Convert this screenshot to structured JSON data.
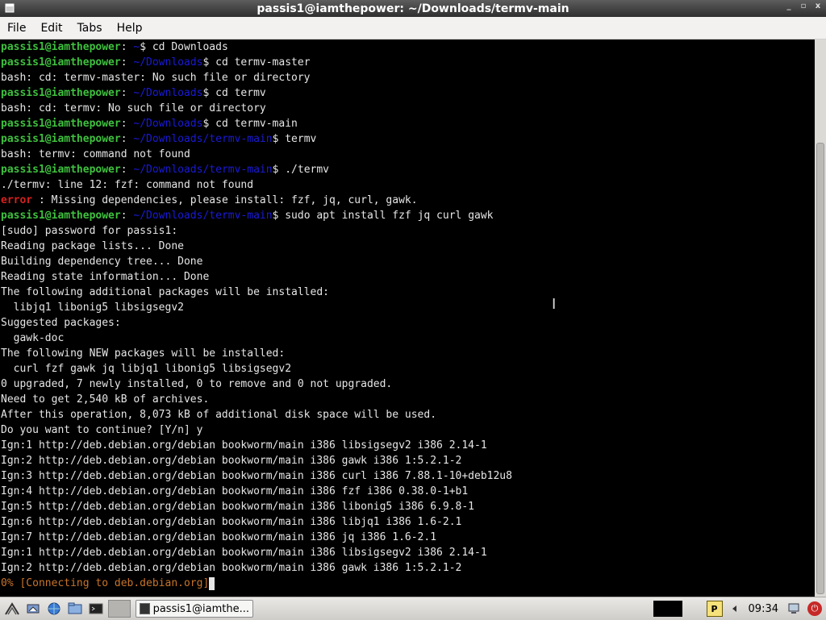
{
  "window": {
    "title": "passis1@iamthepower: ~/Downloads/termv-main",
    "controls": [
      "_",
      "▫",
      "x"
    ]
  },
  "menubar": {
    "items": [
      "File",
      "Edit",
      "Tabs",
      "Help"
    ]
  },
  "terminal": {
    "lines": [
      {
        "type": "prompt",
        "host": "passis1@iamthepower",
        "path": "~",
        "cmd": "$ cd Downloads"
      },
      {
        "type": "prompt",
        "host": "passis1@iamthepower",
        "path": "~/Downloads",
        "cmd": "$ cd termv-master"
      },
      {
        "type": "out",
        "text": "bash: cd: termv-master: No such file or directory"
      },
      {
        "type": "prompt",
        "host": "passis1@iamthepower",
        "path": "~/Downloads",
        "cmd": "$ cd termv"
      },
      {
        "type": "out",
        "text": "bash: cd: termv: No such file or directory"
      },
      {
        "type": "prompt",
        "host": "passis1@iamthepower",
        "path": "~/Downloads",
        "cmd": "$ cd termv-main"
      },
      {
        "type": "prompt",
        "host": "passis1@iamthepower",
        "path": "~/Downloads/termv-main",
        "cmd": "$ termv"
      },
      {
        "type": "out",
        "text": "bash: termv: command not found"
      },
      {
        "type": "prompt",
        "host": "passis1@iamthepower",
        "path": "~/Downloads/termv-main",
        "cmd": "$ ./termv"
      },
      {
        "type": "out",
        "text": "./termv: line 12: fzf: command not found"
      },
      {
        "type": "error",
        "label": "error",
        "text": " : Missing dependencies, please install: fzf, jq, curl, gawk."
      },
      {
        "type": "prompt",
        "host": "passis1@iamthepower",
        "path": "~/Downloads/termv-main",
        "cmd": "$ sudo apt install fzf jq curl gawk"
      },
      {
        "type": "out",
        "text": "[sudo] password for passis1:"
      },
      {
        "type": "out",
        "text": "Reading package lists... Done"
      },
      {
        "type": "out",
        "text": "Building dependency tree... Done"
      },
      {
        "type": "out",
        "text": "Reading state information... Done"
      },
      {
        "type": "out",
        "text": "The following additional packages will be installed:"
      },
      {
        "type": "out",
        "text": "  libjq1 libonig5 libsigsegv2"
      },
      {
        "type": "out",
        "text": "Suggested packages:"
      },
      {
        "type": "out",
        "text": "  gawk-doc"
      },
      {
        "type": "out",
        "text": "The following NEW packages will be installed:"
      },
      {
        "type": "out",
        "text": "  curl fzf gawk jq libjq1 libonig5 libsigsegv2"
      },
      {
        "type": "out",
        "text": "0 upgraded, 7 newly installed, 0 to remove and 0 not upgraded."
      },
      {
        "type": "out",
        "text": "Need to get 2,540 kB of archives."
      },
      {
        "type": "out",
        "text": "After this operation, 8,073 kB of additional disk space will be used."
      },
      {
        "type": "out",
        "text": "Do you want to continue? [Y/n] y"
      },
      {
        "type": "out",
        "text": "Ign:1 http://deb.debian.org/debian bookworm/main i386 libsigsegv2 i386 2.14-1"
      },
      {
        "type": "out",
        "text": "Ign:2 http://deb.debian.org/debian bookworm/main i386 gawk i386 1:5.2.1-2"
      },
      {
        "type": "out",
        "text": "Ign:3 http://deb.debian.org/debian bookworm/main i386 curl i386 7.88.1-10+deb12u8"
      },
      {
        "type": "out",
        "text": "Ign:4 http://deb.debian.org/debian bookworm/main i386 fzf i386 0.38.0-1+b1"
      },
      {
        "type": "out",
        "text": "Ign:5 http://deb.debian.org/debian bookworm/main i386 libonig5 i386 6.9.8-1"
      },
      {
        "type": "out",
        "text": "Ign:6 http://deb.debian.org/debian bookworm/main i386 libjq1 i386 1.6-2.1"
      },
      {
        "type": "out",
        "text": "Ign:7 http://deb.debian.org/debian bookworm/main i386 jq i386 1.6-2.1"
      },
      {
        "type": "out",
        "text": "Ign:1 http://deb.debian.org/debian bookworm/main i386 libsigsegv2 i386 2.14-1"
      },
      {
        "type": "out",
        "text": "Ign:2 http://deb.debian.org/debian bookworm/main i386 gawk i386 1:5.2.1-2"
      },
      {
        "type": "progress",
        "text": "0% [Connecting to deb.debian.org]"
      }
    ],
    "colors": {
      "host": "#3ec13e",
      "path": "#1a1ad9",
      "error": "#d62020",
      "progress": "#c8742a",
      "text": "#e6e6e6"
    }
  },
  "taskbar": {
    "task_label": "passis1@iamthe...",
    "clock": "09:34",
    "icons": [
      "start-menu-icon",
      "show-desktop-icon",
      "browser-icon",
      "file-manager-icon",
      "terminal-icon",
      "task-terminal-icon",
      "package-updater-icon",
      "network-icon",
      "power-icon"
    ]
  }
}
